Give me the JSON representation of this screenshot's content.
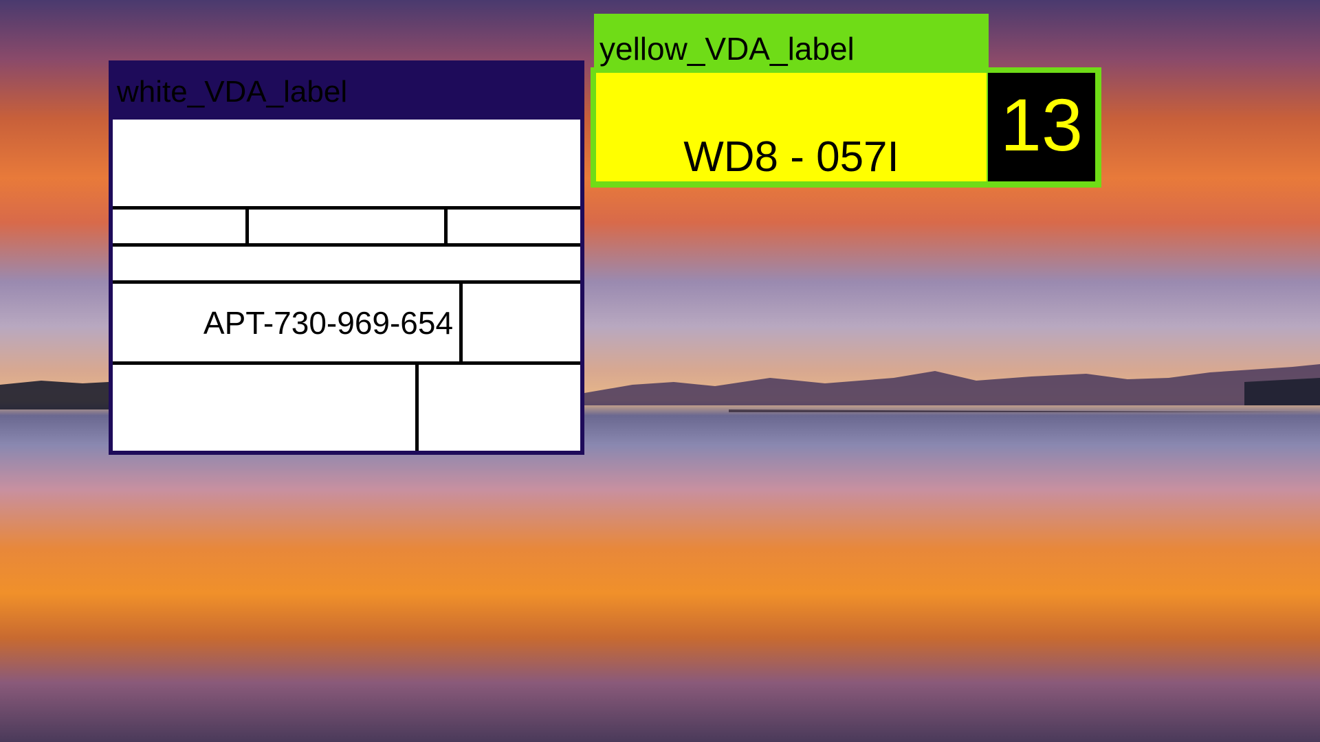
{
  "background": {
    "description_icon": "sunset-lake-wallpaper"
  },
  "white_label": {
    "title": "white_VDA_label",
    "code": "APT-730-969-654",
    "header_color": "#1e0b5a"
  },
  "yellow_label": {
    "title": "yellow_VDA_label",
    "code": "WD8 - 057I",
    "number": "13",
    "header_color": "#6fdc17",
    "box_color": "#ffff00"
  }
}
